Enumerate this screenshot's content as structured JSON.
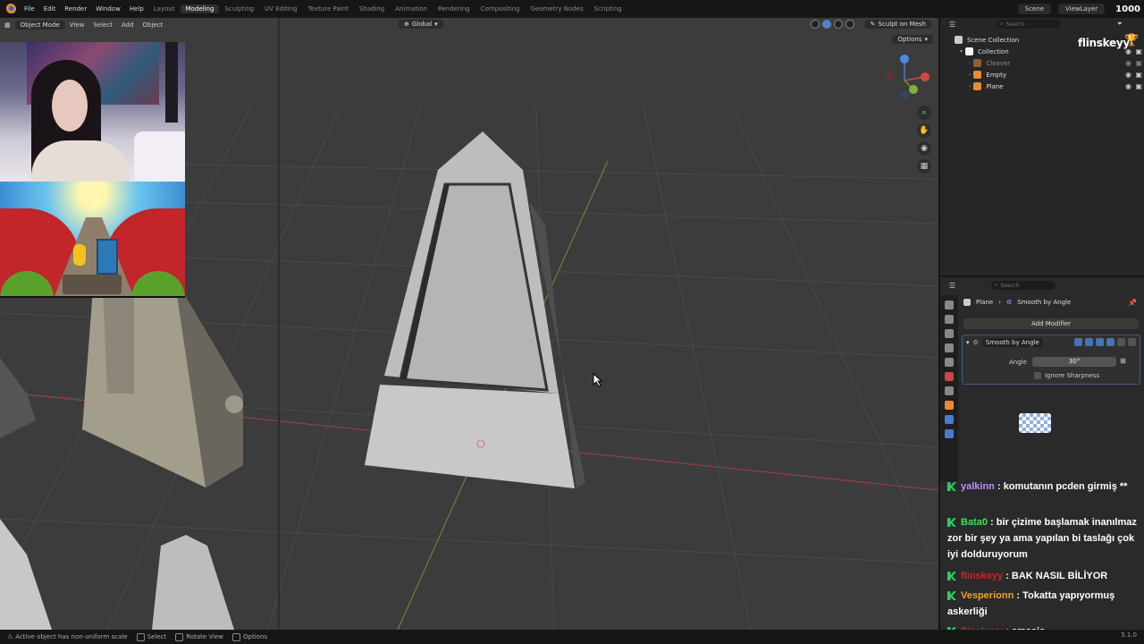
{
  "menubar": {
    "menus": [
      "File",
      "Edit",
      "Render",
      "Window",
      "Help"
    ],
    "workspaces": [
      "Layout",
      "Modeling",
      "Sculpting",
      "UV Editing",
      "Texture Paint",
      "Shading",
      "Animation",
      "Rendering",
      "Compositing",
      "Geometry Nodes",
      "Scripting"
    ],
    "active_workspace": "Modeling",
    "scene": "Scene",
    "view_layer": "ViewLayer",
    "frame_count": "1000"
  },
  "viewport": {
    "mode": "Object Mode",
    "menus": [
      "View",
      "Select",
      "Add",
      "Object"
    ],
    "orientation": "Global",
    "sculpt_button": "Sculpt on Mesh",
    "options": "Options"
  },
  "outliner": {
    "search_placeholder": "Search",
    "scene_collection": "Scene Collection",
    "collection": "Collection",
    "items": [
      {
        "name": "Cleaver",
        "color": "#e88a3a"
      },
      {
        "name": "Empty",
        "color": "#e88a3a"
      },
      {
        "name": "Plane",
        "color": "#e88a3a"
      }
    ],
    "streamer": "flinskeyy"
  },
  "properties": {
    "search_placeholder": "Search",
    "breadcrumb_object": "Plane",
    "breadcrumb_modifier": "Smooth by Angle",
    "add_modifier": "Add Modifier",
    "modifier_name": "Smooth by Angle",
    "angle_label": "Angle",
    "angle_value": "30°",
    "ignore_sharpness": "Ignore Sharpness"
  },
  "chat": [
    {
      "user": "yalkinn",
      "user_color": "#c08bff",
      "text": "komutanın pcden girmiş **"
    },
    {
      "user": "Bata0",
      "user_color": "#3ee05a",
      "text": "bir çizime başlamak inanılmaz zor bir şey ya ama yapılan bi taslağı çok iyi dolduruyorum"
    },
    {
      "user": "flinskeyy",
      "user_color": "#d4202a",
      "text": "BAK NASIL BİLİYOR"
    },
    {
      "user": "Vesperionn",
      "user_color": "#f2a12c",
      "text": "Tokatta yapıyormuş askerliği"
    },
    {
      "user": "flinskeyy",
      "user_color": "#d4202a",
      "text": "amasia"
    }
  ],
  "statusbar": {
    "message": "Active object has non-uniform scale",
    "select": "Select",
    "rotate": "Rotate View",
    "options": "Options",
    "version": "5.1.0"
  }
}
